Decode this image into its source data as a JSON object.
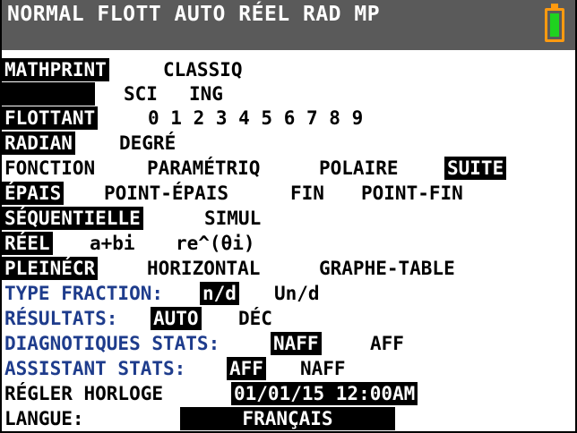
{
  "status_bar": {
    "text": "NORMAL FLOTT AUTO RÉEL RAD MP",
    "battery_icon": "battery-charging-icon",
    "colors": {
      "background": "#5a5a5a",
      "battery_outline": "#ff9a10",
      "battery_fill": "#1fd21f"
    }
  },
  "mode": {
    "display": {
      "mathprint": "MATHPRINT",
      "classiq": "CLASSIQ"
    },
    "notation": {
      "normal": "",
      "sci": "SCI",
      "ing": "ING"
    },
    "float": {
      "flottant": "FLOTTANT",
      "digits": "0 1 2 3 4 5 6 7 8 9"
    },
    "angle": {
      "radian": "RADIAN",
      "degre": "DEGRÉ"
    },
    "graph_type": {
      "fonction": "FONCTION",
      "parametriq": "PARAMÉTRIQ",
      "polaire": "POLAIRE",
      "suite": "SUITE"
    },
    "line_style": {
      "epais": "ÉPAIS",
      "point_epais": "POINT-ÉPAIS",
      "fin": "FIN",
      "point_fin": "POINT-FIN"
    },
    "plot_order": {
      "sequentielle": "SÉQUENTIELLE",
      "simul": "SIMUL"
    },
    "complex": {
      "reel": "RÉEL",
      "rect": "a+bi",
      "polar": "re^(θi)"
    },
    "screen_split": {
      "pleinecr": "PLEINÉCR",
      "horizontal": "HORIZONTAL",
      "graphe_table": "GRAPHE-TABLE"
    },
    "type_fraction": {
      "label": "TYPE FRACTION:",
      "nd": "n/d",
      "und": "Un/d"
    },
    "resultats": {
      "label": "RÉSULTATS:",
      "auto": "AUTO",
      "dec": "DÉC"
    },
    "diagnostics": {
      "label": "DIAGNOTIQUES STATS:",
      "naff": "NAFF",
      "aff": "AFF"
    },
    "assistant": {
      "label": "ASSISTANT STATS:",
      "aff": "AFF",
      "naff": "NAFF"
    },
    "horloge": {
      "label": "RÉGLER HORLOGE",
      "value": "01/01/15 12:00AM"
    },
    "langue": {
      "label": "LANGUE:",
      "value": "FRANÇAIS"
    }
  }
}
